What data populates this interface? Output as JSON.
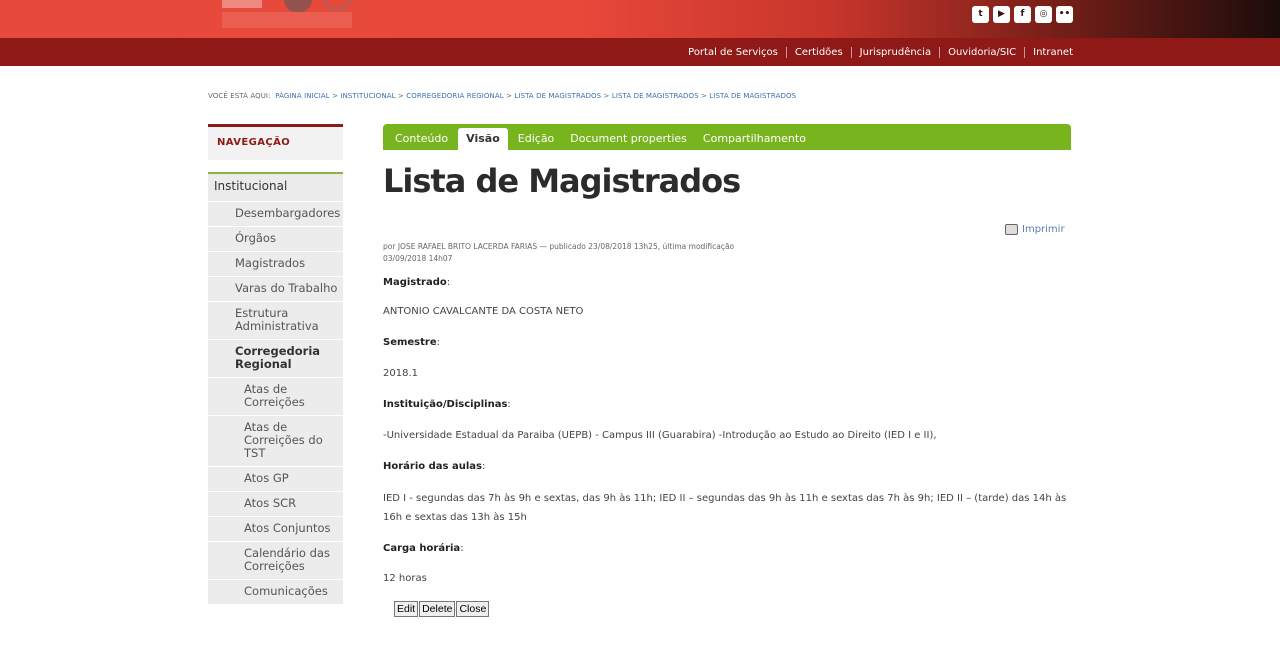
{
  "header": {
    "social_icons": [
      "twitter-icon",
      "youtube-icon",
      "facebook-icon",
      "instagram-icon",
      "flickr-icon"
    ],
    "links": [
      "Portal de Serviços",
      "Certidões",
      "Jurisprudência",
      "Ouvidoria/SIC",
      "Intranet"
    ]
  },
  "breadcrumb": {
    "prefix": "VOCÊ ESTÁ AQUI:",
    "items": [
      "PÁGINA INICIAL",
      "INSTITUCIONAL",
      "CORREGEDORIA REGIONAL",
      "LISTA DE MAGISTRADOS",
      "LISTA DE MAGISTRADOS",
      "LISTA DE MAGISTRADOS"
    ],
    "sep": ">"
  },
  "sidebar": {
    "heading": "NAVEGAÇÃO",
    "section": "Institucional",
    "items": [
      "Desembargadores",
      "Órgãos",
      "Magistrados",
      "Varas do Trabalho",
      "Estrutura Administrativa",
      "Corregedoria Regional",
      "Atas de Correições",
      "Atas de Correições do TST",
      "Atos GP",
      "Atos SCR",
      "Atos Conjuntos",
      "Calendário das Correições",
      "Comunicações"
    ]
  },
  "tabs": [
    "Conteúdo",
    "Visão",
    "Edição",
    "Document properties",
    "Compartilhamento"
  ],
  "page": {
    "title": "Lista de Magistrados",
    "print_label": "Imprimir",
    "byline": "por JOSE RAFAEL BRITO LACERDA FARIAS — publicado 23/08/2018 13h25, última modificação 03/09/2018 14h07"
  },
  "fields": {
    "magistrado_label": "Magistrado",
    "magistrado_value": "ANTONIO CAVALCANTE DA COSTA NETO",
    "semestre_label": "Semestre",
    "semestre_value": "2018.1",
    "instituicao_label": "Instituição/Disciplinas",
    "instituicao_value": "-Universidade Estadual da Paraiba (UEPB) - Campus III (Guarabira) -Introdução ao Estudo ao Direito (IED I e II),",
    "horario_label": "Horário das aulas",
    "horario_value": "IED I - segundas das 7h às 9h e sextas, das 9h às 11h; IED II – segundas das 9h às 11h e sextas das 7h às 9h; IED II – (tarde) das 14h às 16h e sextas das 13h às 15h",
    "carga_label": "Carga horária",
    "carga_value": "12 horas"
  },
  "buttons": {
    "edit": "Edit",
    "delete": "Delete",
    "close": "Close"
  },
  "colors": {
    "accent_red": "#8e1916",
    "tab_green": "#77b41e",
    "link_blue": "#3b6fb0"
  }
}
